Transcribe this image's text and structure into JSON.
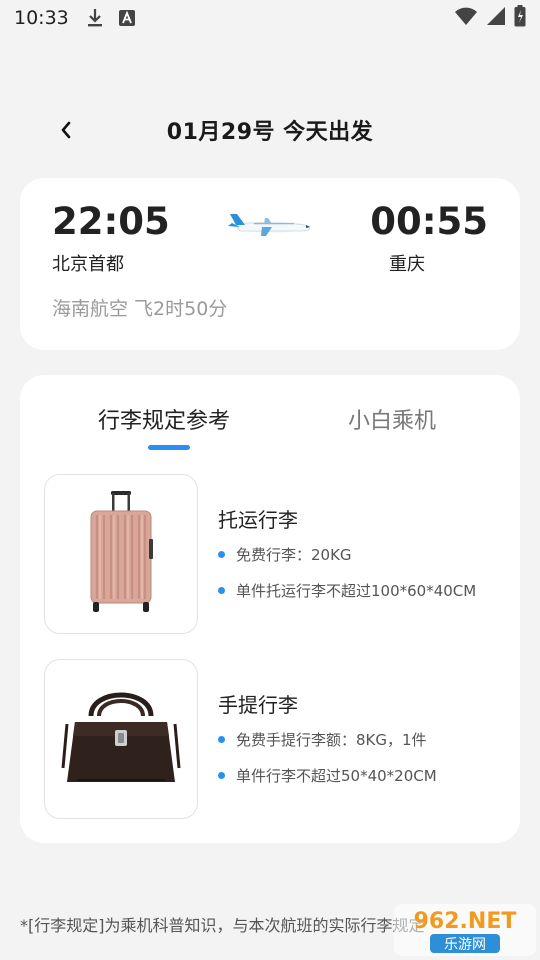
{
  "status_bar": {
    "time": "10:33",
    "icons": [
      "download-icon",
      "a-icon",
      "wifi-icon",
      "signal-icon",
      "battery-icon"
    ]
  },
  "header": {
    "title": "01月29号 今天出发",
    "back_icon": "chevron-left-icon"
  },
  "flight": {
    "departure_time": "22:05",
    "departure_city": "北京首都",
    "arrival_time": "00:55",
    "arrival_city": "重庆",
    "meta": "海南航空 飞2时50分",
    "plane_icon": "airplane-icon"
  },
  "baggage": {
    "tabs": [
      {
        "label": "行李规定参考",
        "active": true
      },
      {
        "label": "小白乘机",
        "active": false
      }
    ],
    "items": [
      {
        "title": "托运行李",
        "image": "suitcase-image",
        "bullets": [
          "免费行李：20KG",
          "单件托运行李不超过100*60*40CM"
        ]
      },
      {
        "title": "手提行李",
        "image": "handbag-image",
        "bullets": [
          "免费手提行李额：8KG，1件",
          "单件行李不超过50*40*20CM"
        ]
      }
    ]
  },
  "footer": {
    "note": "*[行李规定]为乘机科普知识，与本次航班的实际行李规定"
  },
  "watermark": {
    "text_top": "962.NET",
    "text_bottom": "乐游网"
  },
  "colors": {
    "accent": "#2a8ff2",
    "background": "#f3f3f3",
    "card": "#ffffff",
    "muted": "#9a9a9a"
  }
}
